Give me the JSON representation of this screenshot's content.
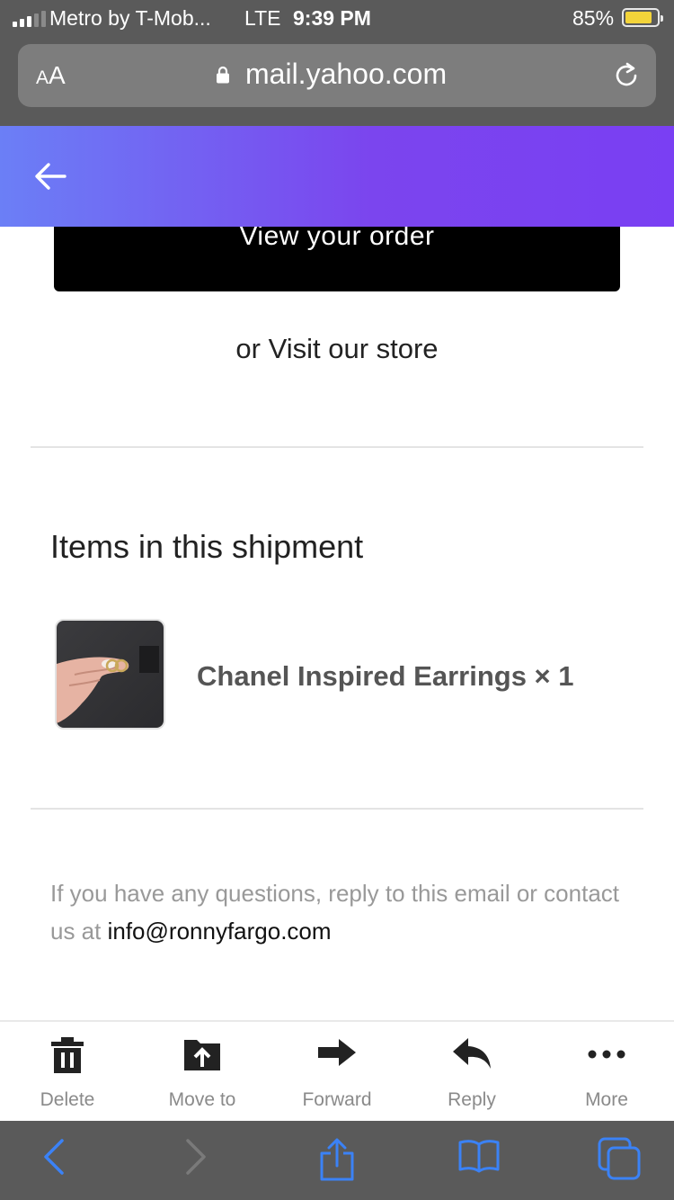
{
  "status_bar": {
    "carrier": "Metro by T-Mob...",
    "network": "LTE",
    "time": "9:39 PM",
    "battery_percent": "85%",
    "battery_level": 0.85,
    "battery_color": "#f3d43a"
  },
  "safari_url_bar": {
    "text_size_button": "AA",
    "url": "mail.yahoo.com"
  },
  "mail_header": {
    "gradient_start": "#6b7ff6",
    "gradient_end": "#7a3ff3"
  },
  "email": {
    "order_button_label": "View your order",
    "visit_store_text": "or Visit our store",
    "shipment_heading": "Items in this shipment",
    "item": {
      "name": "Chanel Inspired Earrings × 1"
    },
    "footer_text": "If you have any questions, reply to this email or contact us at ",
    "contact_email": "info@ronnyfargo.com"
  },
  "action_toolbar": {
    "items": [
      {
        "label": "Delete",
        "icon": "trash-icon"
      },
      {
        "label": "Move to",
        "icon": "move-folder-icon"
      },
      {
        "label": "Forward",
        "icon": "forward-arrow-icon"
      },
      {
        "label": "Reply",
        "icon": "reply-arrow-icon"
      },
      {
        "label": "More",
        "icon": "more-dots-icon"
      }
    ]
  },
  "safari_toolbar": {
    "icons": [
      "back-chevron-icon",
      "forward-chevron-icon",
      "share-icon",
      "bookmarks-icon",
      "tabs-icon"
    ],
    "accent_color": "#3b82f6"
  }
}
